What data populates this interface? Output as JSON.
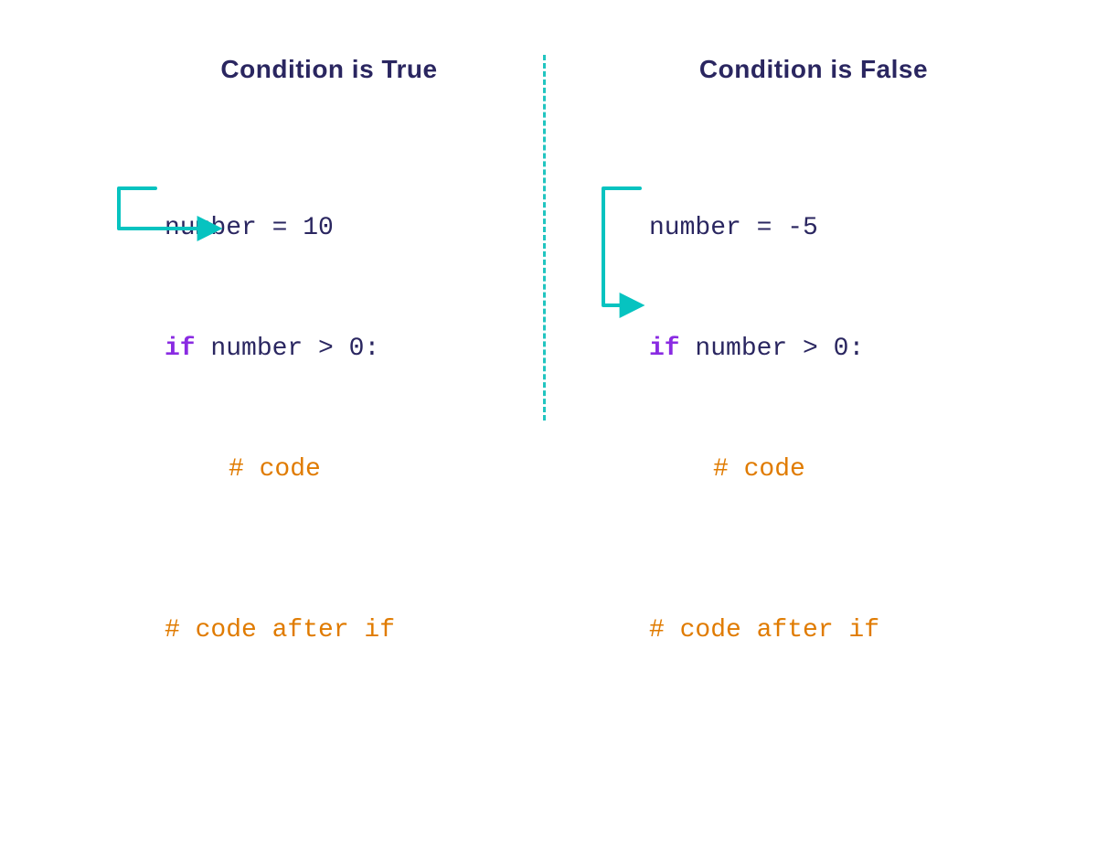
{
  "left": {
    "heading": "Condition is True",
    "line1_a": "number = ",
    "line1_val": "10",
    "line2_kw": "if",
    "line2_cond": " number > ",
    "line2_val": "0",
    "line2_colon": ":",
    "line3": "# code",
    "line4": "# code after if"
  },
  "right": {
    "heading": "Condition is False",
    "line1_a": "number = -",
    "line1_val": "5",
    "line2_kw": "if",
    "line2_cond": " number > ",
    "line2_val": "0",
    "line2_colon": ":",
    "line3": "# code",
    "line4": "# code after if"
  },
  "colors": {
    "accent": "#06c3c0",
    "heading": "#2a2660",
    "keyword": "#8a2be2",
    "comment": "#e07b00"
  }
}
